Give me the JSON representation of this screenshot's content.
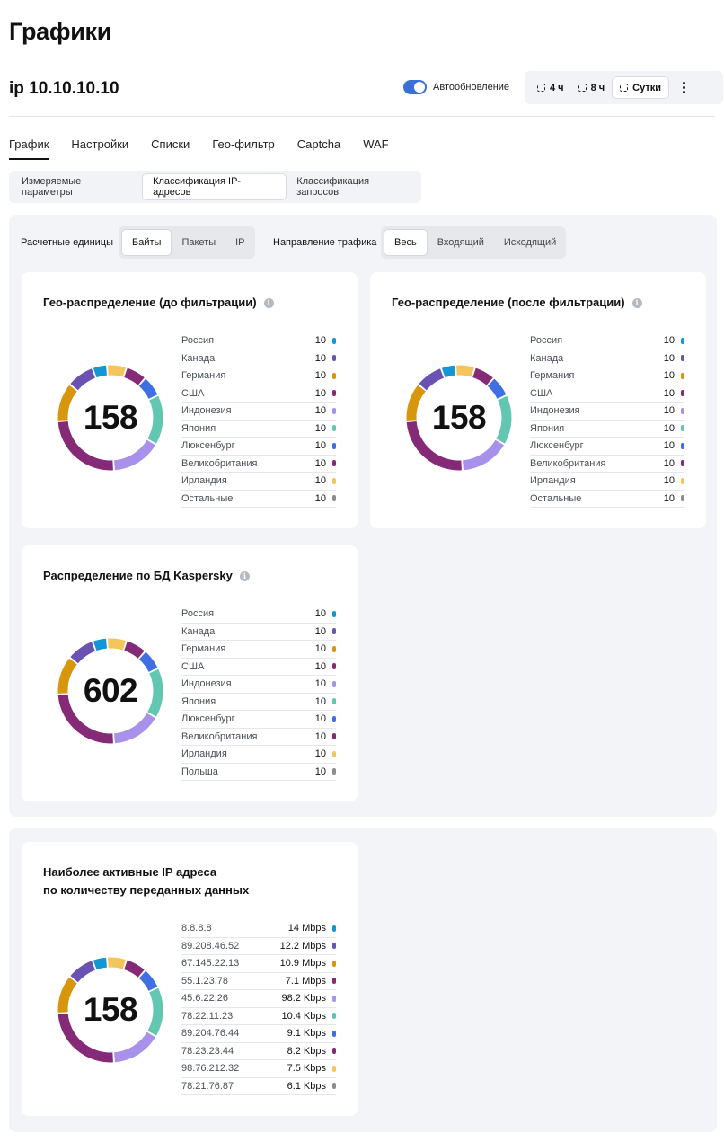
{
  "page_title": "Графики",
  "ip_title": "ip 10.10.10.10",
  "auto_refresh": {
    "label": "Автообновление",
    "enabled": true
  },
  "time_range": {
    "options": [
      "4 ч",
      "8 ч",
      "Сутки"
    ],
    "selected": "Сутки"
  },
  "main_tabs": {
    "items": [
      "График",
      "Настройки",
      "Списки",
      "Гео-фильтр",
      "Captcha",
      "WAF"
    ],
    "active": "График"
  },
  "sub_tabs": {
    "items": [
      "Измеряемые параметры",
      "Классификация IP-адресов",
      "Классификация запросов"
    ],
    "active": "Классификация IP-адресов"
  },
  "controls": {
    "units": {
      "label": "Расчетные единицы",
      "options": [
        "Байты",
        "Пакеты",
        "IP"
      ],
      "selected": "Байты"
    },
    "direction": {
      "label": "Направление трафика",
      "options": [
        "Весь",
        "Входящий",
        "Исходящий"
      ],
      "selected": "Весь"
    }
  },
  "colors": [
    "#1496d4",
    "#6a52b3",
    "#d8960d",
    "#852a77",
    "#a891ea",
    "#62c7b0",
    "#3f6fe3",
    "#852a77",
    "#f3c55a",
    "#8a8d93"
  ],
  "cards": [
    {
      "title": "Гео-распределение (до фильтрации)",
      "total": "158",
      "rows": [
        {
          "name": "Россия",
          "value": "10"
        },
        {
          "name": "Канада",
          "value": "10"
        },
        {
          "name": "Германия",
          "value": "10"
        },
        {
          "name": "США",
          "value": "10"
        },
        {
          "name": "Индонезия",
          "value": "10"
        },
        {
          "name": "Япония",
          "value": "10"
        },
        {
          "name": "Люксенбург",
          "value": "10"
        },
        {
          "name": "Великобритания",
          "value": "10"
        },
        {
          "name": "Ирландия",
          "value": "10"
        },
        {
          "name": "Остальные",
          "value": "10"
        }
      ]
    },
    {
      "title": "Гео-распределение (после фильтрации)",
      "total": "158",
      "rows": [
        {
          "name": "Россия",
          "value": "10"
        },
        {
          "name": "Канада",
          "value": "10"
        },
        {
          "name": "Германия",
          "value": "10"
        },
        {
          "name": "США",
          "value": "10"
        },
        {
          "name": "Индонезия",
          "value": "10"
        },
        {
          "name": "Япония",
          "value": "10"
        },
        {
          "name": "Люксенбург",
          "value": "10"
        },
        {
          "name": "Великобритания",
          "value": "10"
        },
        {
          "name": "Ирландия",
          "value": "10"
        },
        {
          "name": "Остальные",
          "value": "10"
        }
      ]
    },
    {
      "title": "Распределение по БД Kaspersky",
      "total": "602",
      "rows": [
        {
          "name": "Россия",
          "value": "10"
        },
        {
          "name": "Канада",
          "value": "10"
        },
        {
          "name": "Германия",
          "value": "10"
        },
        {
          "name": "США",
          "value": "10"
        },
        {
          "name": "Индонезия",
          "value": "10"
        },
        {
          "name": "Япония",
          "value": "10"
        },
        {
          "name": "Люксенбург",
          "value": "10"
        },
        {
          "name": "Великобритания",
          "value": "10"
        },
        {
          "name": "Ирландия",
          "value": "10"
        },
        {
          "name": "Польша",
          "value": "10"
        }
      ]
    },
    {
      "title": "Наиболее активные IP адреса",
      "title_line2": "по количеству переданных данных",
      "total": "158",
      "rows": [
        {
          "name": "8.8.8.8",
          "value": "14 Mbps"
        },
        {
          "name": "89.208.46.52",
          "value": "12.2 Mbps"
        },
        {
          "name": "67.145.22.13",
          "value": "10.9 Mbps"
        },
        {
          "name": "55.1.23.78",
          "value": "7.1 Mbps"
        },
        {
          "name": "45.6.22.26",
          "value": "98.2 Kbps"
        },
        {
          "name": "78.22.11.23",
          "value": "10.4 Kbps"
        },
        {
          "name": "89.204.76.44",
          "value": "9.1 Kbps"
        },
        {
          "name": "78.23.23.44",
          "value": "8.2 Kbps"
        },
        {
          "name": "98.76.212.32",
          "value": "7.5 Kbps"
        },
        {
          "name": "78.21.76.87",
          "value": "6.1 Kbps"
        }
      ]
    }
  ],
  "donut_segments": [
    {
      "color": "#1496d4",
      "fraction": 0.045
    },
    {
      "color": "#f3c55a",
      "fraction": 0.06
    },
    {
      "color": "#852a77",
      "fraction": 0.065
    },
    {
      "color": "#3f6fe3",
      "fraction": 0.065
    },
    {
      "color": "#62c7b0",
      "fraction": 0.155
    },
    {
      "color": "#a891ea",
      "fraction": 0.155
    },
    {
      "color": "#852a77",
      "fraction": 0.25
    },
    {
      "color": "#d8960d",
      "fraction": 0.12
    },
    {
      "color": "#6a52b3",
      "fraction": 0.085
    }
  ]
}
